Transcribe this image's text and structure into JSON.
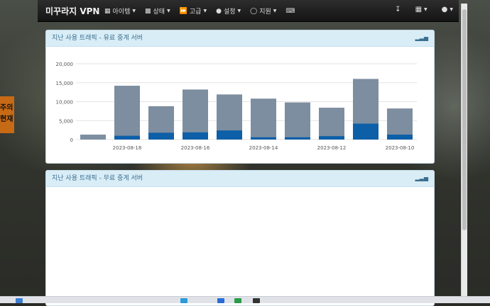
{
  "sidebar_tab": {
    "line1": "주의",
    "line2": "현재"
  },
  "navbar": {
    "brand": "미꾸라지 VPN",
    "menu": [
      {
        "icon": "grid-icon",
        "label": "아이템"
      },
      {
        "icon": "bar-chart-icon",
        "label": "상태"
      },
      {
        "icon": "fast-forward-icon",
        "label": "고급"
      },
      {
        "icon": "user-icon",
        "label": "설정"
      },
      {
        "icon": "headphones-icon",
        "label": "지원"
      }
    ],
    "right_icons": [
      "download-icon",
      "grid-menu-icon",
      "user-menu-icon"
    ]
  },
  "panels": [
    {
      "title": "지난 사용 트래픽 - 유료 중계 서버"
    },
    {
      "title": "지난 사용 트래픽 - 무료 중계 서버"
    }
  ],
  "colors": {
    "bar_total": "#7d8ea0",
    "bar_paid": "#0d5fa8",
    "panel_head_bg": "#d9edf7"
  },
  "chart_data": {
    "type": "bar",
    "y_ticks": [
      "0",
      "5,000",
      "10,000",
      "15,000",
      "20,000"
    ],
    "ylim": [
      0,
      20000
    ],
    "x_tick_labels": [
      "2023-08-18",
      "2023-08-16",
      "2023-08-14",
      "2023-08-12",
      "2023-08-10"
    ],
    "series": [
      {
        "values": [
          1300,
          14200,
          8800,
          13200,
          11900,
          10800,
          9800,
          8400,
          16000,
          8200
        ]
      },
      {
        "values": [
          0,
          1000,
          1800,
          1900,
          2400,
          600,
          600,
          900,
          4200,
          1300
        ]
      }
    ],
    "grid": true
  }
}
